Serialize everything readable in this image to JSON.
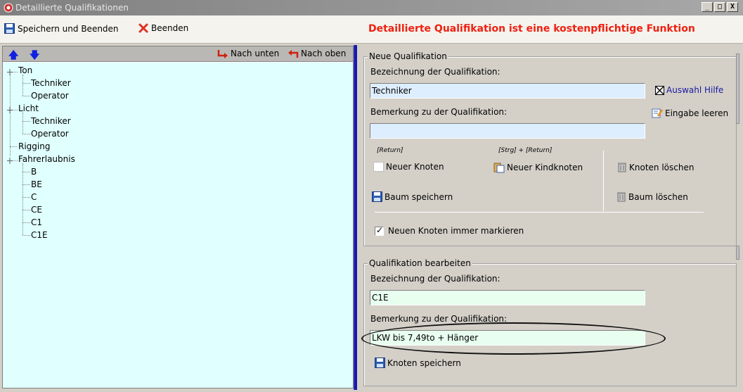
{
  "window": {
    "title": "Detaillierte Qualifikationen",
    "minimize": "_",
    "maximize": "□",
    "close": "X"
  },
  "toolbar": {
    "save_close": "Speichern und Beenden",
    "close": "Beenden",
    "warning": "Detaillierte Qualifikation ist eine kostenpflichtige Funktion"
  },
  "tree_toolbar": {
    "up_arrow": "🡅",
    "down_arrow": "🡇",
    "move_down": "Nach unten",
    "move_up": "Nach oben"
  },
  "tree": [
    {
      "label": "Ton",
      "level": 0,
      "expanded": true
    },
    {
      "label": "Techniker",
      "level": 1
    },
    {
      "label": "Operator",
      "level": 1
    },
    {
      "label": "Licht",
      "level": 0,
      "expanded": true
    },
    {
      "label": "Techniker",
      "level": 1
    },
    {
      "label": "Operator",
      "level": 1
    },
    {
      "label": "Rigging",
      "level": 0
    },
    {
      "label": "Fahrerlaubnis",
      "level": 0,
      "expanded": true
    },
    {
      "label": "B",
      "level": 1
    },
    {
      "label": "BE",
      "level": 1
    },
    {
      "label": "C",
      "level": 1
    },
    {
      "label": "CE",
      "level": 1
    },
    {
      "label": "C1",
      "level": 1
    },
    {
      "label": "C1E",
      "level": 1
    }
  ],
  "new_qual": {
    "group_title": "Neue Qualifikation",
    "name_label": "Bezeichnung der Qualifikation:",
    "name_value": "Techniker",
    "help_label": "Auswahl Hilfe",
    "note_label": "Bemerkung zu der Qualifikation:",
    "note_value": "",
    "clear_label": "Eingabe leeren",
    "hint_return": "[Return]",
    "hint_ctrl_return": "[Strg] + [Return]",
    "new_node": "Neuer Knoten",
    "new_child": "Neuer Kindknoten",
    "delete_node": "Knoten löschen",
    "save_tree": "Baum speichern",
    "delete_tree": "Baum löschen",
    "always_mark": "Neuen Knoten immer markieren"
  },
  "edit_qual": {
    "group_title": "Qualifikation bearbeiten",
    "name_label": "Bezeichnung der Qualifikation:",
    "name_value": "C1E",
    "note_label": "Bemerkung zu der Qualifikation:",
    "note_value": "LKW bis 7,49to + Hänger",
    "save_node": "Knoten speichern"
  },
  "colors": {
    "warning": "#f02010",
    "tree_bg": "#e0ffff",
    "splitter": "#1a1aa8",
    "input_blue": "#ddeeff",
    "input_green": "#e8fff0"
  }
}
